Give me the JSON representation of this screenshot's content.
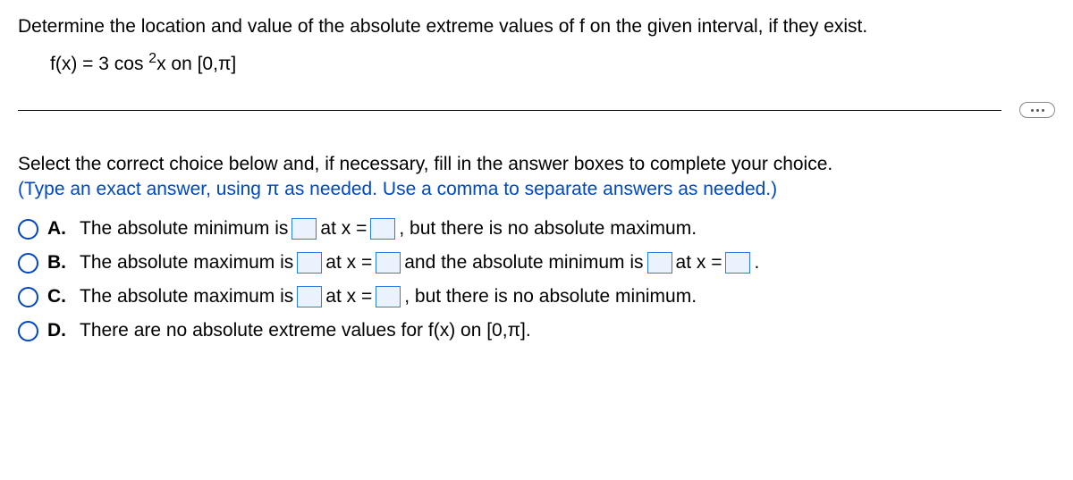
{
  "question": "Determine the location and value of the absolute extreme values of f on the given interval, if they exist.",
  "func": {
    "lhs": "f(x) = 3 cos",
    "exp": "2",
    "rhs": "x on [0,π]"
  },
  "instructions": "Select the correct choice below and, if necessary, fill in the answer boxes to complete your choice.",
  "instructions_sub": "(Type an exact answer, using π as needed. Use a comma to separate answers as needed.)",
  "choices": {
    "a": {
      "letter": "A.",
      "p1": "The absolute minimum is",
      "p2": "at x =",
      "p3": ", but there is no absolute maximum."
    },
    "b": {
      "letter": "B.",
      "p1": "The absolute maximum is",
      "p2": "at x =",
      "p3": "and the absolute minimum is",
      "p4": "at x =",
      "p5": "."
    },
    "c": {
      "letter": "C.",
      "p1": "The absolute maximum is",
      "p2": "at x =",
      "p3": ", but there is no absolute minimum."
    },
    "d": {
      "letter": "D.",
      "p1": "There are no absolute extreme values for f(x) on [0,π]."
    }
  }
}
